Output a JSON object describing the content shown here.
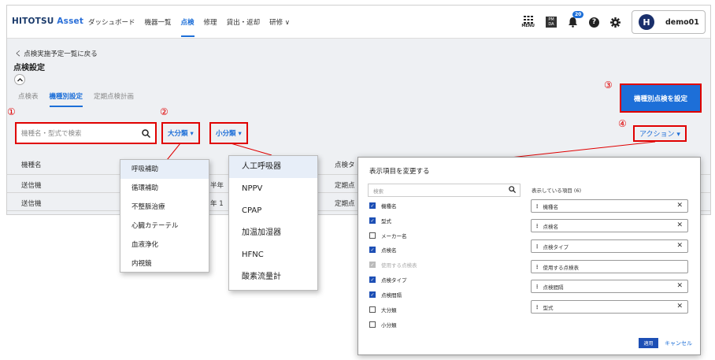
{
  "header": {
    "logo_main": "HITOTSU",
    "logo_sub": "Asset",
    "nav": [
      "ダッシュボード",
      "機器一覧",
      "点検",
      "修理",
      "貸出・返却",
      "研修 ∨"
    ],
    "menu_label": "MENU",
    "pm_label": "PM DA",
    "notification_count": "20",
    "user_initial": "H",
    "user_name": "demo01"
  },
  "page": {
    "back_link": "く 点検実施予定一覧に戻る",
    "title": "点検設定",
    "tabs": [
      "点検表",
      "機種別設定",
      "定期点検計画"
    ],
    "set_button": "機種別点検を設定",
    "search_placeholder": "機種名・型式で検索",
    "filter_major": "大分類 ▾",
    "filter_minor": "小分類 ▾",
    "action_button": "アクション ▾"
  },
  "table": {
    "headers": [
      "機種名",
      "点検タ"
    ],
    "rows": [
      {
        "name": "送信機",
        "mid": "半年",
        "type": "定期点"
      },
      {
        "name": "送信機",
        "mid": "年 1",
        "type": "定期点"
      }
    ]
  },
  "annotations": [
    "①",
    "②",
    "③",
    "④"
  ],
  "dropdown_major": [
    "呼吸補助",
    "循環補助",
    "不整脈治療",
    "心臓カテーテル",
    "血液浄化",
    "内視鏡"
  ],
  "dropdown_minor": [
    "人工呼吸器",
    "NPPV",
    "CPAP",
    "加温加湿器",
    "HFNC",
    "酸素流量計"
  ],
  "column_panel": {
    "title": "表示項目を変更する",
    "search_placeholder": "検索",
    "shown_label": "表示している項目 (6)",
    "checkboxes": [
      {
        "label": "機種名",
        "state": "on"
      },
      {
        "label": "型式",
        "state": "on"
      },
      {
        "label": "メーカー名",
        "state": "off"
      },
      {
        "label": "点検名",
        "state": "on"
      },
      {
        "label": "使用する点検表",
        "state": "disabled"
      },
      {
        "label": "点検タイプ",
        "state": "on"
      },
      {
        "label": "点検間隔",
        "state": "on"
      },
      {
        "label": "大分類",
        "state": "off"
      },
      {
        "label": "小分類",
        "state": "off"
      }
    ],
    "chips": [
      {
        "label": "機種名",
        "removable": true
      },
      {
        "label": "点検名",
        "removable": true
      },
      {
        "label": "点検タイプ",
        "removable": true
      },
      {
        "label": "使用する点検表",
        "removable": false
      },
      {
        "label": "点検間隔",
        "removable": true
      },
      {
        "label": "型式",
        "removable": true
      }
    ],
    "apply": "適用",
    "cancel": "キャンセル"
  }
}
